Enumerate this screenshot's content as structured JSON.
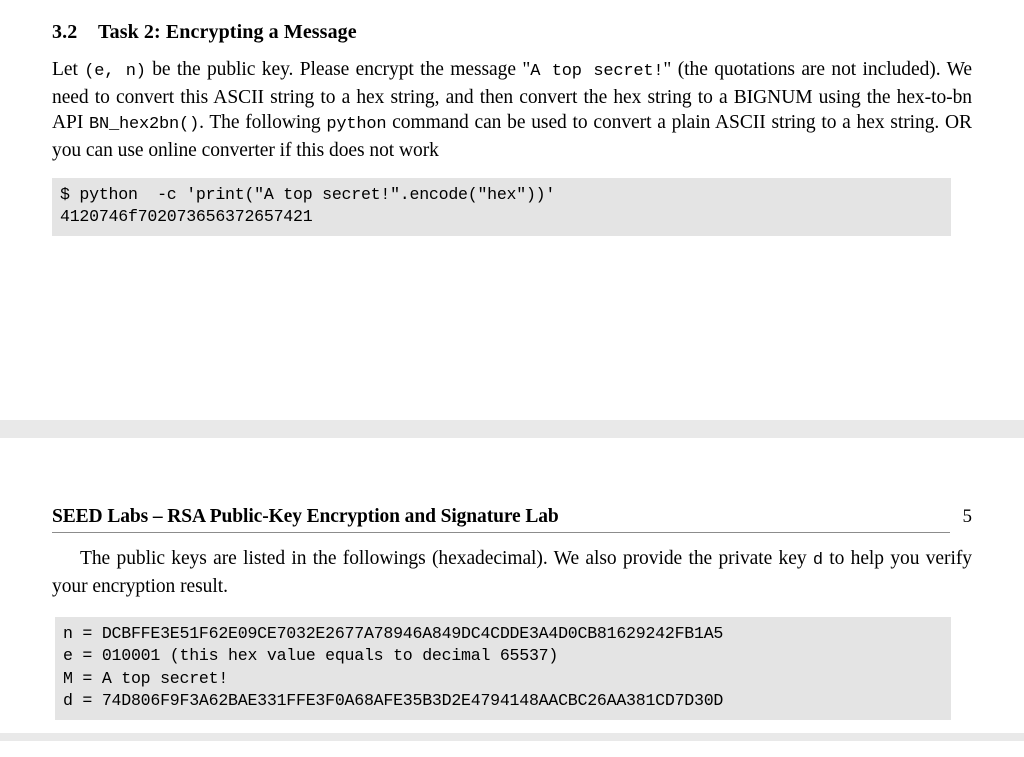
{
  "document": {
    "page_top": {
      "heading": {
        "number": "3.2",
        "title": "Task 2: Encrypting a Message"
      },
      "paragraph": {
        "part1": "Let ",
        "mono1": "(e, n)",
        "part2": " be the public key. Please encrypt the message \"",
        "mono2": "A top secret!",
        "part3": "\" (the quotations are not included). We need to convert this ASCII string to a hex string, and then convert the hex string to a BIGNUM using the hex-to-bn API ",
        "mono3": "BN_hex2bn()",
        "part4": ". The following ",
        "mono4": "python",
        "part5": " command can be used to convert a plain ASCII string to a hex string. OR you can use online converter if this does not work"
      },
      "code_block": "$ python  -c 'print(\"A top secret!\".encode(\"hex\"))'\n4120746f702073656372657421"
    },
    "page_bottom": {
      "running_head": {
        "title": "SEED Labs – RSA Public-Key Encryption and Signature Lab",
        "page_number": "5"
      },
      "paragraph": {
        "part1": "The public keys are listed in the followings (hexadecimal). We also provide the private key ",
        "mono1": "d",
        "part2": " to help you verify your encryption result."
      },
      "code_block": "n = DCBFFE3E51F62E09CE7032E2677A78946A849DC4CDDE3A4D0CB81629242FB1A5\ne = 010001 (this hex value equals to decimal 65537)\nM = A top secret!\nd = 74D806F9F3A62BAE331FFE3F0A68AFE35B3D2E4794148AACBC26AA381CD7D30D"
    }
  },
  "colors": {
    "code_background": "#e4e4e4",
    "page_gap": "#e9e9e9",
    "rule": "#8c8c8c",
    "text": "#000000"
  }
}
